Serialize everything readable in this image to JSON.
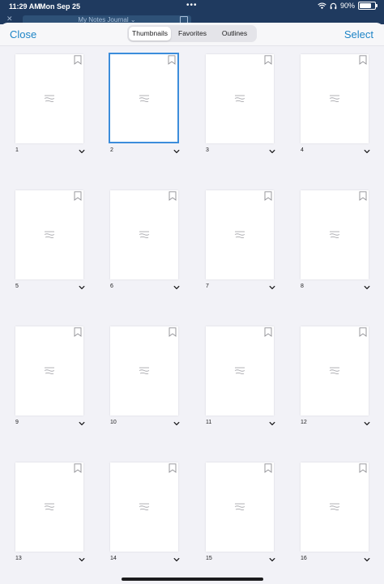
{
  "status_bar": {
    "time": "11:29 AM",
    "date": "Mon Sep 25",
    "battery": "90%",
    "battery_level": 0.9,
    "wifi_icon": "wifi-icon",
    "headphones_icon": "headphones-icon"
  },
  "app_bar": {
    "document_title": "My Notes Journal"
  },
  "toolbar": {
    "close_label": "Close",
    "select_label": "Select",
    "tabs": [
      {
        "label": "Thumbnails",
        "active": true
      },
      {
        "label": "Favorites",
        "active": false
      },
      {
        "label": "Outlines",
        "active": false
      }
    ]
  },
  "pages": [
    {
      "number": "1"
    },
    {
      "number": "2",
      "selected": true
    },
    {
      "number": "3"
    },
    {
      "number": "4"
    },
    {
      "number": "5"
    },
    {
      "number": "6"
    },
    {
      "number": "7"
    },
    {
      "number": "8"
    },
    {
      "number": "9"
    },
    {
      "number": "10"
    },
    {
      "number": "11"
    },
    {
      "number": "12"
    },
    {
      "number": "13"
    },
    {
      "number": "14"
    },
    {
      "number": "15"
    },
    {
      "number": "16"
    }
  ],
  "colors": {
    "accent": "#1d84c6",
    "selection": "#3c8ddb",
    "status_bar": "#1f3a5f"
  }
}
